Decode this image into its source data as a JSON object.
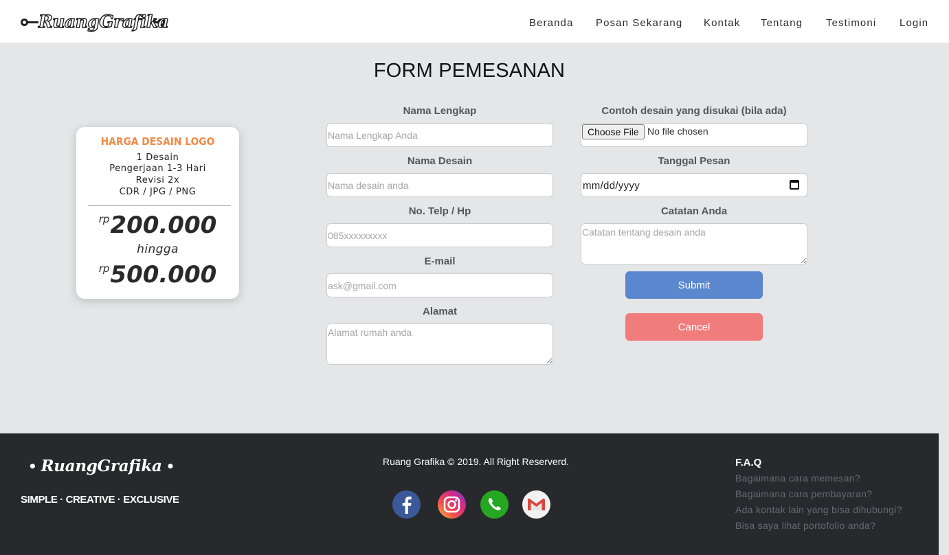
{
  "brand": {
    "name": "RuangGrafika"
  },
  "nav": {
    "items": [
      {
        "label": "Beranda"
      },
      {
        "label": "Posan Sekarang"
      },
      {
        "label": "Kontak"
      },
      {
        "label": "Tentang"
      },
      {
        "label": "Testimoni"
      },
      {
        "label": "Login"
      }
    ]
  },
  "page": {
    "title": "FORM PEMESANAN"
  },
  "price_card": {
    "title": "HARGA DESAIN LOGO",
    "features": [
      "1 Desain",
      "Pengerjaan 1-3 Hari",
      "Revisi 2x",
      "CDR / JPG / PNG"
    ],
    "currency": "rp",
    "price_min": "200.000",
    "between": "hingga",
    "price_max": "500.000",
    "accent_color": "#f08a45"
  },
  "form": {
    "nama_lengkap": {
      "label": "Nama Lengkap",
      "placeholder": "Nama Lengkap Anda"
    },
    "nama_desain": {
      "label": "Nama Desain",
      "placeholder": "Nama desain anda"
    },
    "telp": {
      "label": "No. Telp / Hp",
      "placeholder": "085xxxxxxxxx"
    },
    "email": {
      "label": "E-mail",
      "placeholder": "ask@gmail.com"
    },
    "alamat": {
      "label": "Alamat",
      "placeholder": "Alamat rumah anda"
    },
    "contoh_desain": {
      "label": "Contoh desain yang disukai (bila ada)",
      "button": "Choose File",
      "status": "No file chosen"
    },
    "tanggal": {
      "label": "Tanggal Pesan",
      "value": "mm/dd/yyyy",
      "icon": "calendar-icon"
    },
    "catatan": {
      "label": "Catatan Anda",
      "placeholder": "Catatan tentang desain anda"
    },
    "submit": {
      "label": "Submit",
      "color": "#5b87cf"
    },
    "cancel": {
      "label": "Cancel",
      "color": "#f07c7b"
    }
  },
  "footer": {
    "brand": "RuangGrafika",
    "tagline": "SIMPLE · CREATIVE · EXCLUSIVE",
    "copyright": "Ruang Grafika © 2019. All Right Reserverd.",
    "social": [
      {
        "icon": "facebook-icon"
      },
      {
        "icon": "instagram-icon"
      },
      {
        "icon": "whatsapp-icon"
      },
      {
        "icon": "gmail-icon"
      }
    ],
    "faq": {
      "title": "F.A.Q",
      "items": [
        "Bagaimana cara memesan?",
        "Bagaimana cara pembayaran?",
        "Ada kontak lain yang bisa dihubungi?",
        "Bisa saya lihat portofolio anda?"
      ]
    },
    "background": "#27292c"
  }
}
